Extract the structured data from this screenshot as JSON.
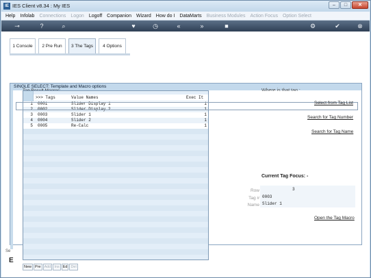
{
  "window": {
    "title": "IES Client v8.34 : My IES"
  },
  "menu": {
    "items": [
      {
        "label": "Help",
        "enabled": true
      },
      {
        "label": "Infolab",
        "enabled": true
      },
      {
        "label": "Connections",
        "enabled": false
      },
      {
        "label": "Logon",
        "enabled": false
      },
      {
        "label": "Logoff",
        "enabled": true
      },
      {
        "label": "Companion",
        "enabled": true
      },
      {
        "label": "Wizard",
        "enabled": true
      },
      {
        "label": "How do I",
        "enabled": true
      },
      {
        "label": "DataMarts",
        "enabled": true
      },
      {
        "label": "Business Modules",
        "enabled": false
      },
      {
        "label": "Action Focus",
        "enabled": false
      },
      {
        "label": "Option Select",
        "enabled": false
      }
    ]
  },
  "toolbar": {
    "icons": [
      "key-icon",
      "help-icon",
      "search-icon",
      "heart-icon",
      "clock-icon",
      "rewind-icon",
      "fast-forward-icon",
      "stop-icon",
      "gear-icon",
      "check-icon",
      "close-icon"
    ]
  },
  "tabs": [
    {
      "label": "1 Console"
    },
    {
      "label": "2 Pre Run"
    },
    {
      "label": "3 The Tags"
    },
    {
      "label": "4 Options"
    }
  ],
  "modal": {
    "title": "SINGLE SELECT: Template and Macro options"
  },
  "grid": {
    "clipped_label": "Tag Result Macros:",
    "header": {
      "tags": ">>> Tags",
      "value_names": "Value Names",
      "exec": "Exec It"
    },
    "rows": [
      {
        "num": "1",
        "tag": "0001",
        "name": "Slider Display 1",
        "exec": "1"
      },
      {
        "num": "2",
        "tag": "0002",
        "name": "Slider Display 2",
        "exec": "1"
      },
      {
        "num": "3",
        "tag": "0003",
        "name": "Slider 1",
        "exec": "1"
      },
      {
        "num": "4",
        "tag": "0004",
        "name": "Slider 2",
        "exec": "1"
      },
      {
        "num": "5",
        "tag": "0005",
        "name": "Re-Calc",
        "exec": "1"
      }
    ]
  },
  "nav_buttons": [
    {
      "label": "New",
      "enabled": true
    },
    {
      "label": "Pre",
      "enabled": true
    },
    {
      "label": "Add",
      "enabled": false
    },
    {
      "label": "Ins",
      "enabled": false
    },
    {
      "label": "Ed",
      "enabled": true
    },
    {
      "label": "Del",
      "enabled": false
    }
  ],
  "right_panel": {
    "where_label": "Where is that tag :",
    "links": {
      "select_from_list": "Select from Tag List",
      "search_number": "Search for Tag Number",
      "search_name": "Search for Tag Name",
      "open_macro": "Open the Tag Macro"
    },
    "focus": {
      "title": "Current Tag Focus: -",
      "row_label": "Row",
      "row_value": "3",
      "tag_label": "Tag #",
      "tag_value": "0003",
      "name_label": "Name",
      "name_value": "Slider 1"
    }
  },
  "bottom": {
    "letter": "E",
    "small": "Se"
  }
}
